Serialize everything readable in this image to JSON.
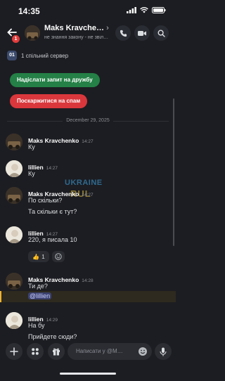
{
  "status_bar": {
    "time": "14:35"
  },
  "header": {
    "back_badge": "1",
    "title": "Maks Kravche…",
    "subtitle": "не знання закону - не звіл…"
  },
  "server_info": {
    "icon_text": "01",
    "text": "1 спільний сервер"
  },
  "actions": {
    "friend_request": "Надіслати запит на дружбу",
    "report_spam": "Поскаржитися на спам"
  },
  "date_divider": "December 29, 2025",
  "watermark": {
    "line1": "UKRAINE",
    "line2": "RUL"
  },
  "messages": [
    {
      "name": "Maks Kravchenko",
      "time": "14:27",
      "lines": [
        "Ку"
      ]
    },
    {
      "name": "lillien",
      "time": "14:27",
      "lines": [
        "Ку"
      ]
    },
    {
      "name": "Maks Kravchenko",
      "time": "14:27",
      "lines": [
        "По скільки?",
        "Та скільки є тут?"
      ]
    },
    {
      "name": "lillien",
      "time": "14:27",
      "lines": [
        "220, я писала 10"
      ],
      "reaction_count": "1"
    },
    {
      "name": "Maks Kravchenko",
      "time": "14:28",
      "lines": [
        "Ти де?"
      ],
      "mention": "@lillien"
    },
    {
      "name": "lillien",
      "time": "14:29",
      "lines": [
        "На бу",
        "Прийдете сюди?"
      ]
    }
  ],
  "composer": {
    "placeholder": "Написати у @M…"
  }
}
